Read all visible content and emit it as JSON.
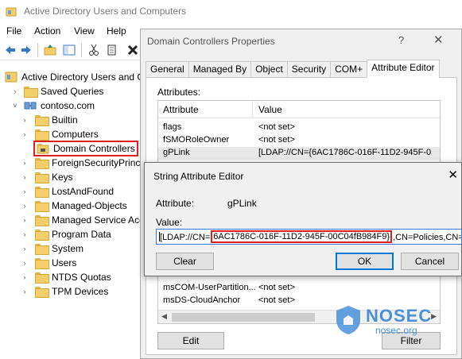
{
  "main": {
    "title": "Active Directory Users and Computers",
    "menu": [
      "File",
      "Action",
      "View",
      "Help"
    ]
  },
  "tree": {
    "root": "Active Directory Users and C",
    "items": [
      {
        "label": "Saved Queries"
      },
      {
        "label": "contoso.com"
      },
      {
        "label": "Builtin"
      },
      {
        "label": "Computers"
      },
      {
        "label": "Domain Controllers"
      },
      {
        "label": "ForeignSecurityPrinc"
      },
      {
        "label": "Keys"
      },
      {
        "label": "LostAndFound"
      },
      {
        "label": "Managed-Objects"
      },
      {
        "label": "Managed Service Acc"
      },
      {
        "label": "Program Data"
      },
      {
        "label": "System"
      },
      {
        "label": "Users"
      },
      {
        "label": "NTDS Quotas"
      },
      {
        "label": "TPM Devices"
      }
    ]
  },
  "props": {
    "title": "Domain Controllers Properties",
    "help": "?",
    "close": "✕",
    "tabs": [
      "General",
      "Managed By",
      "Object",
      "Security",
      "COM+",
      "Attribute Editor"
    ],
    "attributes_caption": "Attributes:",
    "col_attribute": "Attribute",
    "col_value": "Value",
    "rows_top": [
      {
        "attr": "flags",
        "value": "<not set>"
      },
      {
        "attr": "fSMORoleOwner",
        "value": "<not set>"
      },
      {
        "attr": "gPLink",
        "value": "[LDAP://CN={6AC1786C-016F-11D2-945F-0"
      }
    ],
    "rows_bottom": [
      {
        "attr": "msCOM-UserPartition...",
        "value": "<not set>"
      },
      {
        "attr": "msDS-CloudAnchor",
        "value": "<not set>"
      }
    ],
    "edit_label": "Edit",
    "filter_label": "Filter"
  },
  "editor": {
    "title": "String Attribute Editor",
    "close": "✕",
    "attribute_label": "Attribute:",
    "attribute_value": "gPLink",
    "value_label": "Value:",
    "value_prefix": "[LDAP://CN=",
    "value_guid": "6AC1786C-016F-11D2-945F-00C04fB984F9}",
    "value_suffix": ",CN=Policies,CN=Sys",
    "clear_label": "Clear",
    "ok_label": "OK",
    "cancel_label": "Cancel"
  },
  "watermark": {
    "brand": "NOSEC",
    "site": "nosec.org"
  }
}
